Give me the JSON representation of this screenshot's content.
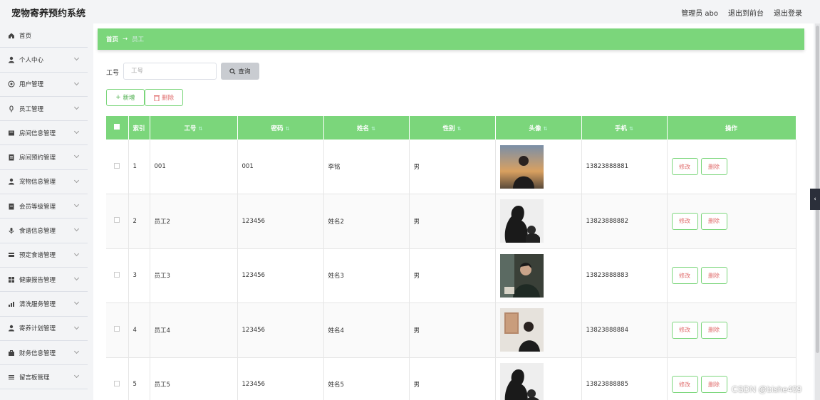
{
  "app": {
    "title": "宠物寄养预约系统"
  },
  "header": {
    "admin": "管理员 abo",
    "front": "退出到前台",
    "logout": "退出登录"
  },
  "sidebar": {
    "items": [
      {
        "label": "首页",
        "icon": "home-icon",
        "chevron": false
      },
      {
        "label": "个人中心",
        "icon": "user-icon",
        "chevron": true
      },
      {
        "label": "用户管理",
        "icon": "users-icon",
        "chevron": true
      },
      {
        "label": "员工管理",
        "icon": "staff-icon",
        "chevron": true
      },
      {
        "label": "房间信息管理",
        "icon": "room-icon",
        "chevron": true
      },
      {
        "label": "房间预约管理",
        "icon": "booking-icon",
        "chevron": true
      },
      {
        "label": "宠物信息管理",
        "icon": "pet-icon",
        "chevron": true
      },
      {
        "label": "会员等级管理",
        "icon": "member-icon",
        "chevron": true
      },
      {
        "label": "食谱信息管理",
        "icon": "recipe-icon",
        "chevron": true
      },
      {
        "label": "预定食谱管理",
        "icon": "order-icon",
        "chevron": true
      },
      {
        "label": "健康报告管理",
        "icon": "report-icon",
        "chevron": true
      },
      {
        "label": "清洗服务管理",
        "icon": "wash-icon",
        "chevron": true
      },
      {
        "label": "寄养计划管理",
        "icon": "plan-icon",
        "chevron": true
      },
      {
        "label": "财务信息管理",
        "icon": "finance-icon",
        "chevron": true
      },
      {
        "label": "留言板管理",
        "icon": "message-icon",
        "chevron": true
      }
    ]
  },
  "breadcrumb": {
    "home": "首页",
    "arrow": "→",
    "current": "员工"
  },
  "search": {
    "label": "工号",
    "placeholder": "工号",
    "button": "查询"
  },
  "actions": {
    "add": "新增",
    "delete": "删除"
  },
  "table": {
    "headers": [
      "索引",
      "工号",
      "密码",
      "姓名",
      "性别",
      "头像",
      "手机",
      "操作"
    ],
    "rows": [
      {
        "index": "1",
        "id": "001",
        "password": "001",
        "name": "李铭",
        "gender": "男",
        "phone": "13823888881",
        "avatar": "photo-sunset-man"
      },
      {
        "index": "2",
        "id": "员工2",
        "password": "123456",
        "name": "姓名2",
        "gender": "男",
        "phone": "13823888882",
        "avatar": "photo-silhouette-man"
      },
      {
        "index": "3",
        "id": "员工3",
        "password": "123456",
        "name": "姓名3",
        "gender": "男",
        "phone": "13823888883",
        "avatar": "photo-cafe-man"
      },
      {
        "index": "4",
        "id": "员工4",
        "password": "123456",
        "name": "姓名4",
        "gender": "男",
        "phone": "13823888884",
        "avatar": "photo-gallery-man"
      },
      {
        "index": "5",
        "id": "员工5",
        "password": "123456",
        "name": "姓名5",
        "gender": "男",
        "phone": "13823888885",
        "avatar": "photo-silhouette-man"
      }
    ],
    "edit_label": "修改",
    "delete_label": "删除"
  },
  "watermark": "CSDN @bishe409",
  "colors": {
    "accent": "#7bd67b",
    "danger": "#e06d6d"
  }
}
